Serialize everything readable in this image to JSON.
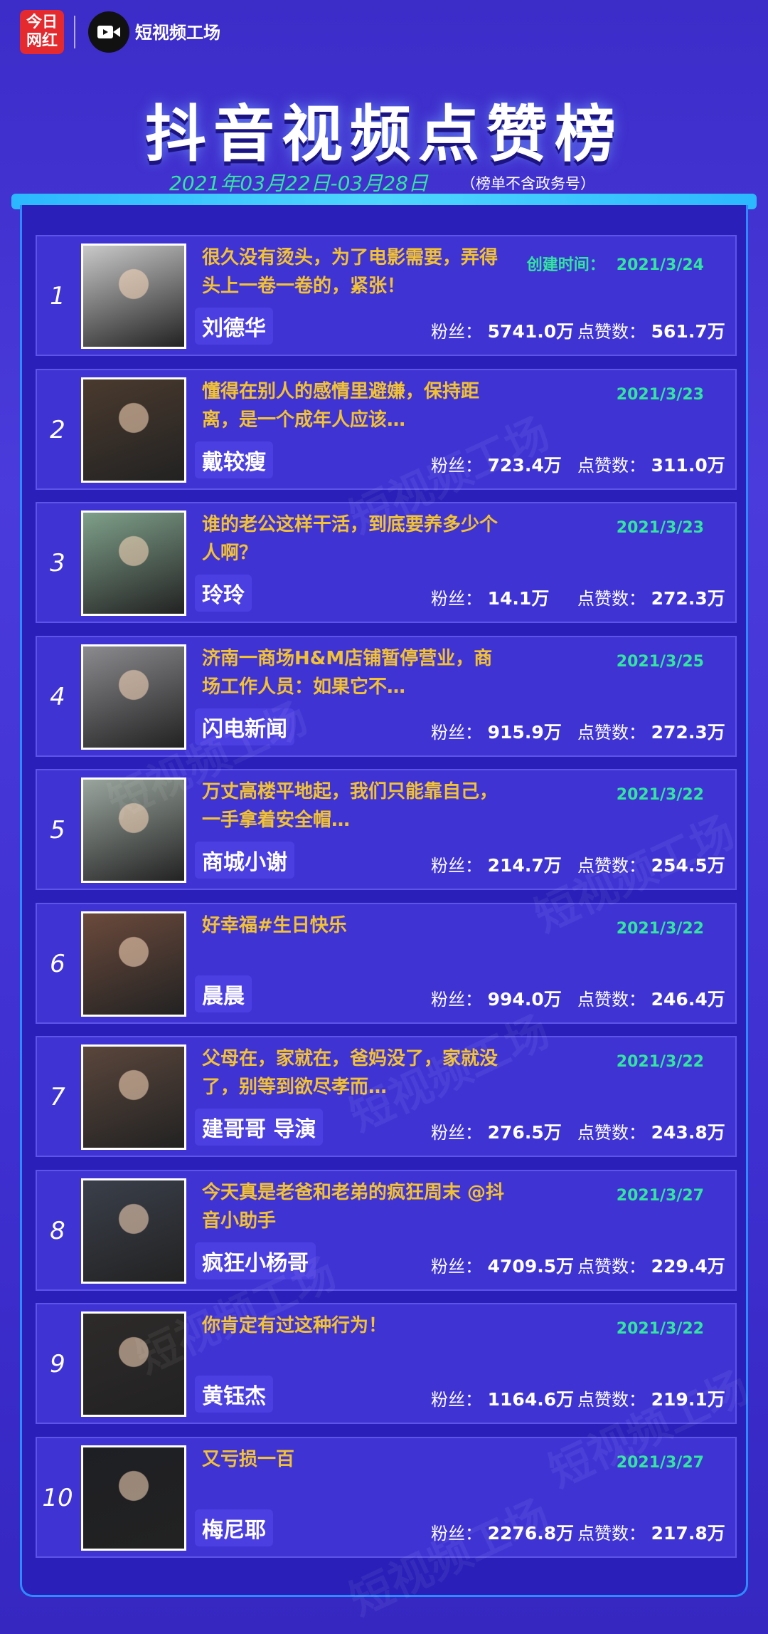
{
  "header": {
    "logo_line1": "今日",
    "logo_line2": "网红",
    "brand": "短视频工场",
    "title": "抖音视频点赞榜",
    "date_range": "2021年03月22日-03月28日",
    "note": "（榜单不含政务号）"
  },
  "labels": {
    "fans": "粉丝：",
    "likes": "点赞数：",
    "created": "创建时间："
  },
  "watermark": "短视频工场",
  "rows": [
    {
      "rank": "1",
      "desc": "很久没有烫头，为了电影需要，弄得头上一卷一卷的，紧张！",
      "author": "刘德华",
      "date": "2021/3/24",
      "fans": "5741.0万",
      "likes": "561.7万",
      "thumb_color": "#c9c9c9"
    },
    {
      "rank": "2",
      "desc": "懂得在别人的感情里避嫌，保持距离，是一个成年人应该…",
      "author": "戴较瘦",
      "date": "2021/3/23",
      "fans": "723.4万",
      "likes": "311.0万",
      "thumb_color": "#4a3a2e"
    },
    {
      "rank": "3",
      "desc": "谁的老公这样干活，到底要养多少个人啊？",
      "author": "玲玲",
      "date": "2021/3/23",
      "fans": "14.1万",
      "likes": "272.3万",
      "thumb_color": "#7fa08a"
    },
    {
      "rank": "4",
      "desc": "济南一商场H&M店铺暂停营业，商场工作人员：如果它不…",
      "author": "闪电新闻",
      "date": "2021/3/25",
      "fans": "915.9万",
      "likes": "272.3万",
      "thumb_color": "#8b8b8f"
    },
    {
      "rank": "5",
      "desc": "万丈高楼平地起，我们只能靠自己，一手拿着安全帽…",
      "author": "商城小谢",
      "date": "2021/3/22",
      "fans": "214.7万",
      "likes": "254.5万",
      "thumb_color": "#9aa59e"
    },
    {
      "rank": "6",
      "desc": "好幸福#生日快乐",
      "author": "晨晨",
      "date": "2021/3/22",
      "fans": "994.0万",
      "likes": "246.4万",
      "thumb_color": "#6b4a3c"
    },
    {
      "rank": "7",
      "desc": "父母在，家就在，爸妈没了，家就没了，别等到欲尽孝而…",
      "author": "建哥哥 导演",
      "date": "2021/3/22",
      "fans": "276.5万",
      "likes": "243.8万",
      "thumb_color": "#5a463c"
    },
    {
      "rank": "8",
      "desc": "今天真是老爸和老弟的疯狂周末 @抖音小助手",
      "author": "疯狂小杨哥",
      "date": "2021/3/27",
      "fans": "4709.5万",
      "likes": "229.4万",
      "thumb_color": "#3a3f4a"
    },
    {
      "rank": "9",
      "desc": "你肯定有过这种行为！",
      "author": "黄钰杰",
      "date": "2021/3/22",
      "fans": "1164.6万",
      "likes": "219.1万",
      "thumb_color": "#2e2a2a"
    },
    {
      "rank": "10",
      "desc": "又亏损一百",
      "author": "梅尼耶",
      "date": "2021/3/27",
      "fans": "2276.8万",
      "likes": "217.8万",
      "thumb_color": "#1e1f24"
    }
  ]
}
